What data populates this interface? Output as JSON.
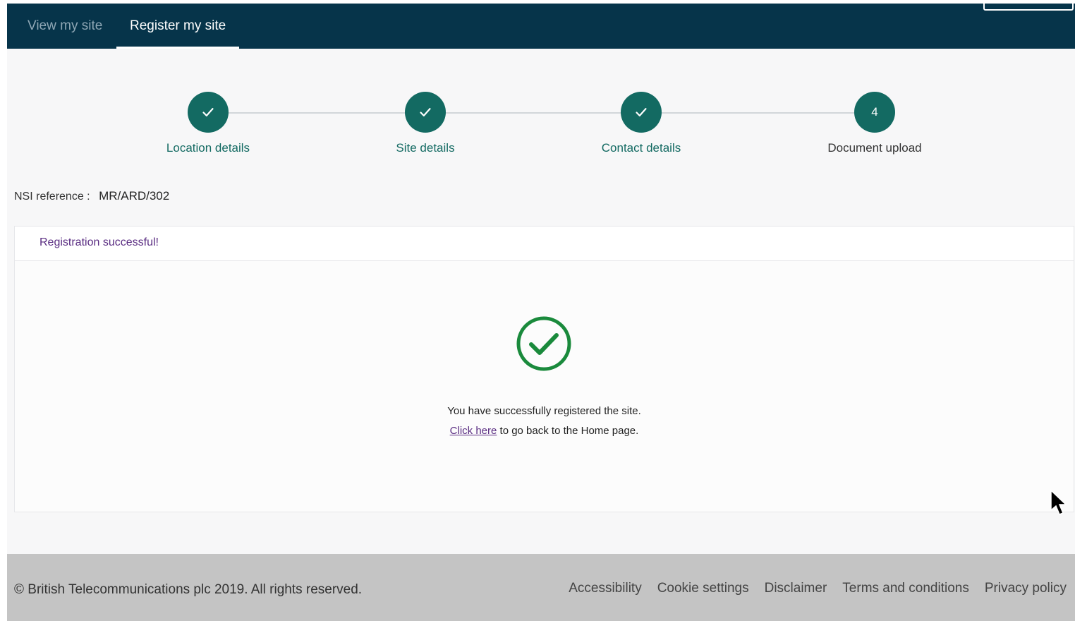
{
  "nav": {
    "tabs": [
      {
        "label": "View my site",
        "active": false
      },
      {
        "label": "Register my site",
        "active": true
      }
    ]
  },
  "stepper": {
    "steps": [
      {
        "label": "Location details",
        "state": "complete",
        "marker": "check-icon"
      },
      {
        "label": "Site details",
        "state": "complete",
        "marker": "check-icon"
      },
      {
        "label": "Contact details",
        "state": "complete",
        "marker": "check-icon"
      },
      {
        "label": "Document upload",
        "state": "current",
        "marker": "4"
      }
    ]
  },
  "reference": {
    "label": "NSI reference :",
    "value": "MR/ARD/302"
  },
  "panel": {
    "title": "Registration successful!",
    "icon": "success-check-circle-icon",
    "message": "You have successfully registered the site.",
    "link_text": "Click here",
    "link_suffix": " to go back to the Home page."
  },
  "footer": {
    "copyright": "© British Telecommunications plc 2019. All rights reserved.",
    "links": [
      "Accessibility",
      "Cookie settings",
      "Disclaimer",
      "Terms and conditions",
      "Privacy policy"
    ]
  },
  "colors": {
    "nav_background": "#06344a",
    "step_complete": "#136a62",
    "success_green": "#1a8a3c",
    "link_purple": "#5a2d82",
    "footer_background": "#c4c4c4"
  }
}
